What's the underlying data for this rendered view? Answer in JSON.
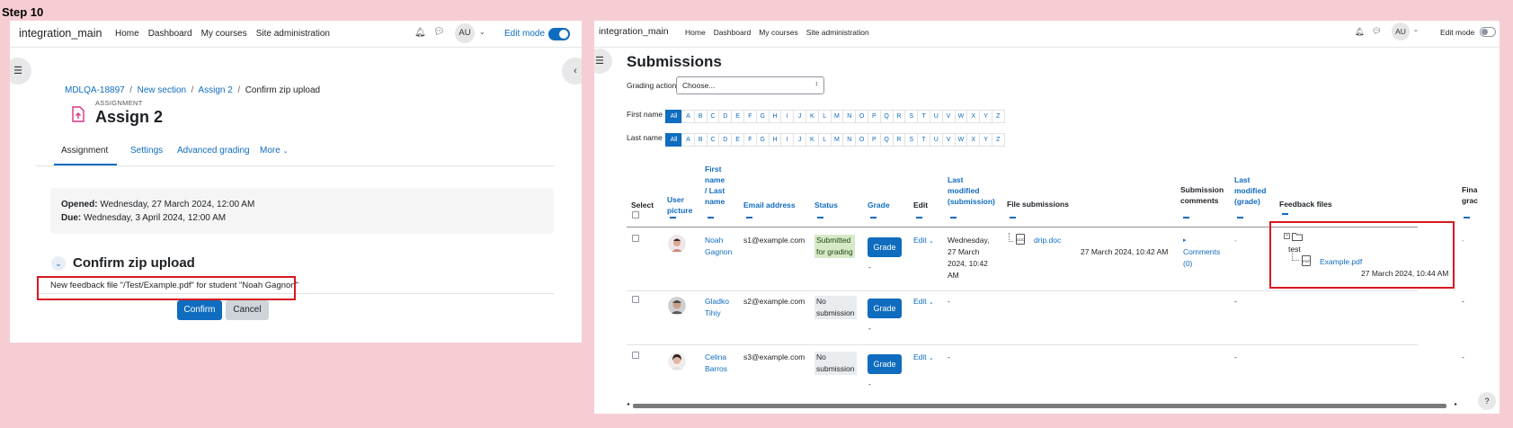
{
  "step_title": "Step 10",
  "left": {
    "nav": {
      "brand": "integration_main",
      "links": [
        "Home",
        "Dashboard",
        "My courses",
        "Site administration"
      ],
      "avatar": "AU",
      "edit_mode": "Edit mode"
    },
    "breadcrumb": [
      "MDLQA-18897",
      "New section",
      "Assign 2",
      "Confirm zip upload"
    ],
    "activity_kind": "ASSIGNMENT",
    "activity_title": "Assign 2",
    "tabs": [
      "Assignment",
      "Settings",
      "Advanced grading",
      "More"
    ],
    "dates": {
      "opened_label": "Opened:",
      "opened_value": "Wednesday, 27 March 2024, 12:00 AM",
      "due_label": "Due:",
      "due_value": "Wednesday, 3 April 2024, 12:00 AM"
    },
    "section_heading": "Confirm zip upload",
    "feedback_message": "New feedback file \"/Test/Example.pdf\" for student \"Noah Gagnon\"",
    "confirm_label": "Confirm",
    "cancel_label": "Cancel"
  },
  "right": {
    "nav": {
      "brand": "integration_main",
      "links": [
        "Home",
        "Dashboard",
        "My courses",
        "Site administration"
      ],
      "avatar": "AU",
      "edit_mode": "Edit mode"
    },
    "title": "Submissions",
    "grading_action_label": "Grading action",
    "grading_action_value": "Choose...",
    "first_name_label": "First name",
    "last_name_label": "Last name",
    "initials_all": "All",
    "initials": [
      "A",
      "B",
      "C",
      "D",
      "E",
      "F",
      "G",
      "H",
      "I",
      "J",
      "K",
      "L",
      "M",
      "N",
      "O",
      "P",
      "Q",
      "R",
      "S",
      "T",
      "U",
      "V",
      "W",
      "X",
      "Y",
      "Z"
    ],
    "headers": {
      "select": "Select",
      "user_picture": [
        "User",
        "picture"
      ],
      "name": [
        "First",
        "name",
        "/ Last",
        "name"
      ],
      "email": "Email address",
      "status": "Status",
      "grade": "Grade",
      "edit": "Edit",
      "last_modified_sub": [
        "Last",
        "modified",
        "(submission)"
      ],
      "file_submissions": "File submissions",
      "submission_comments": [
        "Submission",
        "comments"
      ],
      "last_modified_grade": [
        "Last",
        "modified",
        "(grade)"
      ],
      "feedback_files": "Feedback files",
      "final_grade": [
        "Fina",
        "grac"
      ]
    },
    "grade_button": "Grade",
    "edit_label": "Edit",
    "dash": "-",
    "rows": [
      {
        "first": "Noah",
        "last": "Gagnon",
        "email": "s1@example.com",
        "status": [
          "Submitted",
          "for grading"
        ],
        "grade_extra": "-",
        "last_modified": [
          "Wednesday,",
          "27 March",
          "2024, 10:42",
          "AM"
        ],
        "file_name": "drip.doc",
        "file_date": "27 March 2024, 10:42 AM",
        "comments": [
          "Comments",
          "(0)"
        ],
        "grade_modified": "-",
        "feedback_folder": "test",
        "feedback_file": "Example.pdf",
        "feedback_date": "27 March 2024, 10:44 AM",
        "final": "-"
      },
      {
        "first": "Gladko",
        "last": "Tihiy",
        "email": "s2@example.com",
        "status": [
          "No",
          "submission"
        ],
        "grade_extra": "-",
        "last_modified": [
          "-"
        ],
        "grade_modified": "-",
        "final": "-"
      },
      {
        "first": "Celina",
        "last": "Barros",
        "email": "s3@example.com",
        "status": [
          "No",
          "submission"
        ],
        "grade_extra": "-",
        "last_modified": [
          "-"
        ],
        "grade_modified": "-",
        "final": "-"
      }
    ]
  },
  "colors": {
    "primary": "#0f6cbf",
    "highlight_box": "#d71920",
    "page_bg": "#f7cdd4"
  }
}
